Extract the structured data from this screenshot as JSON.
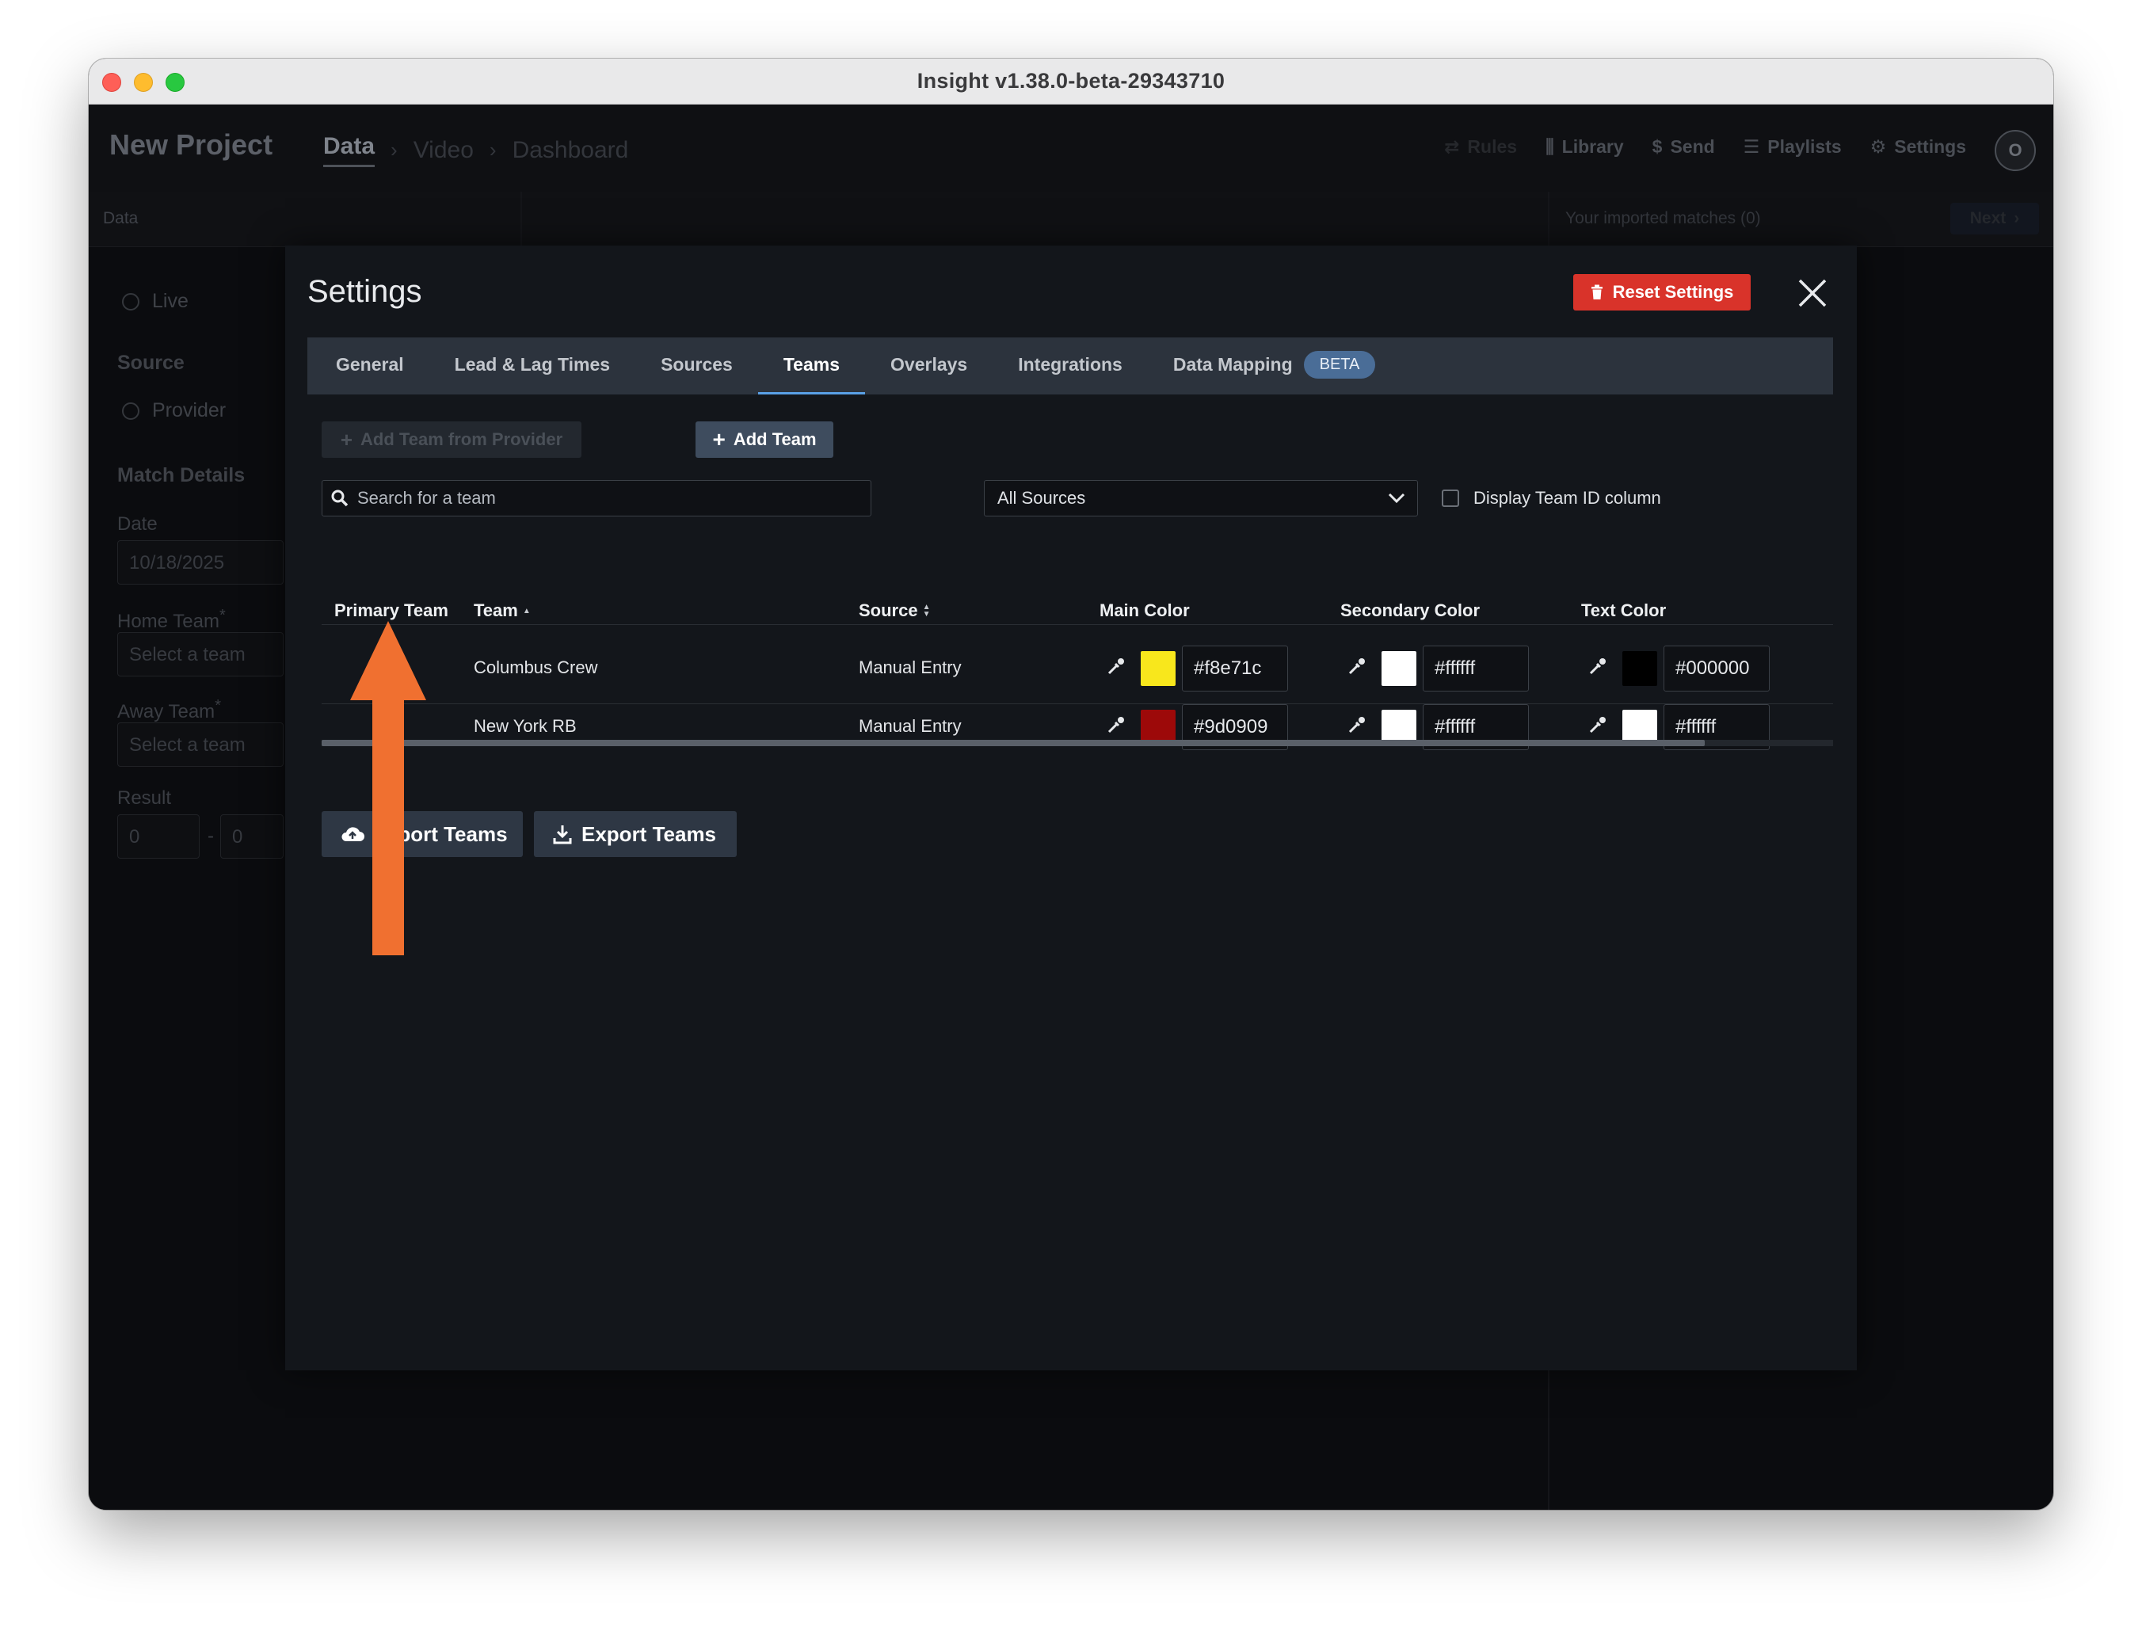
{
  "window": {
    "title": "Insight v1.38.0-beta-29343710"
  },
  "app": {
    "project_title": "New Project",
    "breadcrumbs": [
      "Data",
      "Video",
      "Dashboard"
    ],
    "top_actions": [
      {
        "label": "Rules",
        "icon": "rules-icon"
      },
      {
        "label": "Library",
        "icon": "library-icon"
      },
      {
        "label": "Send",
        "icon": "send-icon"
      },
      {
        "label": "Playlists",
        "icon": "playlists-icon"
      },
      {
        "label": "Settings",
        "icon": "gear-icon"
      }
    ],
    "avatar_initial": "O",
    "subbar": {
      "left_label": "Data",
      "right_label": "Your imported matches (0)",
      "next_label": "Next"
    },
    "left_panel": {
      "live_label": "Live",
      "source_heading": "Source",
      "provider_label": "Provider",
      "match_details_heading": "Match Details",
      "date_label": "Date",
      "date_value": "10/18/2025",
      "home_team_label": "Home Team",
      "home_team_placeholder": "Select a team",
      "away_team_label": "Away Team",
      "away_team_placeholder": "Select a team",
      "result_label": "Result",
      "result_home": "0",
      "result_sep": "-",
      "result_away": "0",
      "required_mark": "*"
    }
  },
  "modal": {
    "title": "Settings",
    "reset_label": "Reset Settings",
    "tabs": [
      "General",
      "Lead & Lag Times",
      "Sources",
      "Teams",
      "Overlays",
      "Integrations",
      "Data Mapping"
    ],
    "active_tab": "Teams",
    "beta_badge": "BETA",
    "add_from_provider_label": "Add Team from Provider",
    "add_team_label": "Add Team",
    "search_placeholder": "Search for a team",
    "source_filter_value": "All Sources",
    "display_team_id_label": "Display Team ID column",
    "columns": {
      "primary": "Primary Team",
      "team": "Team",
      "source": "Source",
      "main_color": "Main Color",
      "secondary_color": "Secondary Color",
      "text_color": "Text Color"
    },
    "rows": [
      {
        "team": "Columbus Crew",
        "source": "Manual Entry",
        "primary": true,
        "main": "#f8e71c",
        "secondary": "#ffffff",
        "text": "#000000"
      },
      {
        "team": "New York RB",
        "source": "Manual Entry",
        "primary": false,
        "main": "#9d0909",
        "secondary": "#ffffff",
        "text": "#ffffff"
      }
    ],
    "import_label": "Import Teams",
    "export_label": "Export Teams"
  },
  "colors": {
    "accent": "#5aa0e6",
    "danger": "#d9332a",
    "annotation_arrow": "#f07030"
  }
}
